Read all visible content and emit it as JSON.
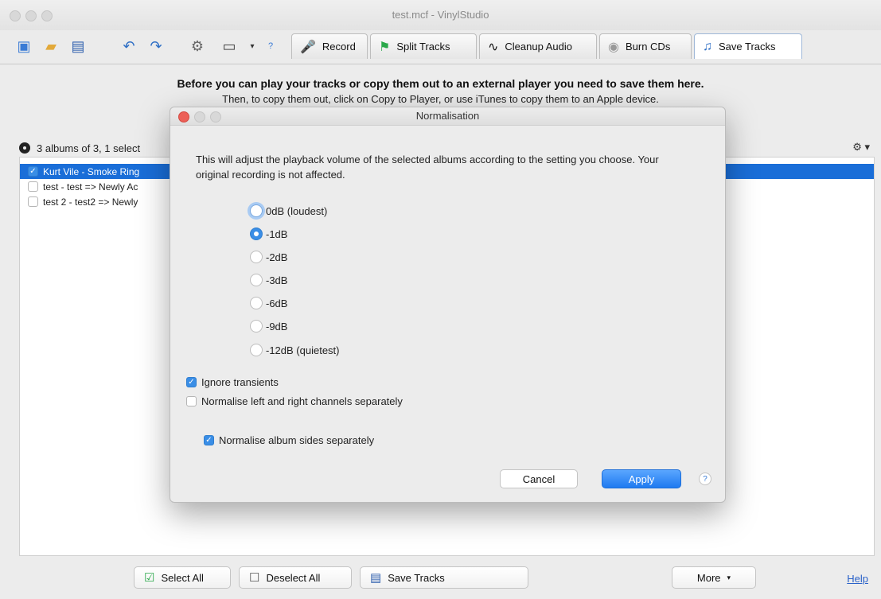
{
  "window": {
    "title": "test.mcf - VinylStudio"
  },
  "toolbar": {
    "icons": [
      "new-file-icon",
      "open-folder-icon",
      "save-icon",
      "undo-icon",
      "redo-icon",
      "settings-gear-icon",
      "new-window-icon",
      "help-icon"
    ],
    "tabs": [
      {
        "label": "Record",
        "icon": "microphone-icon"
      },
      {
        "label": "Split Tracks",
        "icon": "flags-icon"
      },
      {
        "label": "Cleanup Audio",
        "icon": "waveform-icon"
      },
      {
        "label": "Burn CDs",
        "icon": "cd-icon"
      },
      {
        "label": "Save Tracks",
        "icon": "music-note-icon",
        "active": true
      }
    ]
  },
  "main": {
    "info_line1": "Before you can play your tracks or copy them out to an external player you need to save them here.",
    "info_line2": "Then, to copy them out, click on Copy to Player, or use iTunes to copy them to an Apple device.",
    "list_header": "3 albums of 3, 1 select",
    "rows": [
      {
        "label": "Kurt Vile - Smoke Ring",
        "checked": true,
        "selected": true
      },
      {
        "label": "test - test => Newly Ac",
        "checked": false,
        "selected": false
      },
      {
        "label": "test 2 - test2 => Newly",
        "checked": false,
        "selected": false
      }
    ]
  },
  "bottom": {
    "select_all": "Select All",
    "deselect_all": "Deselect All",
    "save_tracks": "Save Tracks",
    "more": "More",
    "help": "Help"
  },
  "dialog": {
    "title": "Normalisation",
    "description": "This will adjust the playback volume of the selected albums according to the setting you choose.  Your original recording is not affected.",
    "options": [
      "0dB (loudest)",
      "-1dB",
      "-2dB",
      "-3dB",
      "-6dB",
      "-9dB",
      "-12dB (quietest)"
    ],
    "selected_option": "-1dB",
    "ignore_transients": {
      "label": "Ignore transients",
      "checked": true
    },
    "normalise_channels": {
      "label": "Normalise left and right channels separately",
      "checked": false
    },
    "normalise_sides": {
      "label": "Normalise album sides separately",
      "checked": true
    },
    "cancel": "Cancel",
    "apply": "Apply",
    "help_glyph": "?"
  },
  "colors": {
    "accent": "#1a6ed8",
    "apply_button": "#2f86f6",
    "close_red": "#ec5f57"
  }
}
